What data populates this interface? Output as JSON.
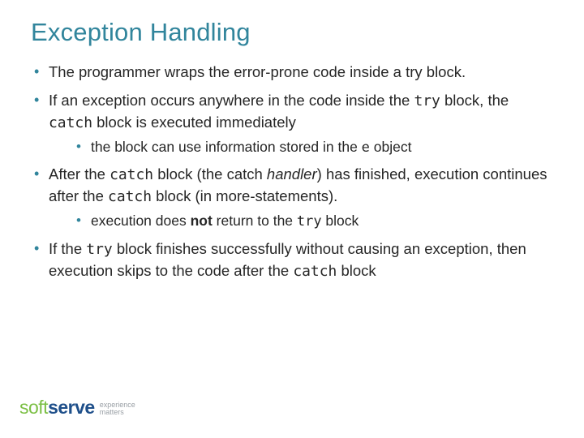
{
  "title": "Exception Handling",
  "bullets": {
    "b1": "The programmer wraps the error-prone code inside a try block.",
    "b2a": "If an exception occurs anywhere in the code inside the ",
    "b2_try": "try",
    "b2b": " block, the ",
    "b2_catch": "catch",
    "b2c": " block is executed immediately",
    "b2s1a": "the block can use information stored in the ",
    "b2s1_e": "e",
    "b2s1b": " object",
    "b3a": "After the ",
    "b3_catch1": "catch",
    "b3b": " block (the catch ",
    "b3_handler": "handler",
    "b3c": ") has finished, execution continues after the ",
    "b3_catch2": "catch",
    "b3d": " block (in more-statements).",
    "b3s1a": "execution does ",
    "b3s1_not": "not",
    "b3s1b": " return to the ",
    "b3s1_try": "try",
    "b3s1c": " block",
    "b4a": "If the ",
    "b4_try": "try",
    "b4b": " block finishes successfully without causing an exception, then execution skips to the code after the ",
    "b4_catch": "catch",
    "b4c": " block"
  },
  "logo": {
    "soft": "soft",
    "serve": "serve",
    "tag1": "experience",
    "tag2": "matters"
  }
}
